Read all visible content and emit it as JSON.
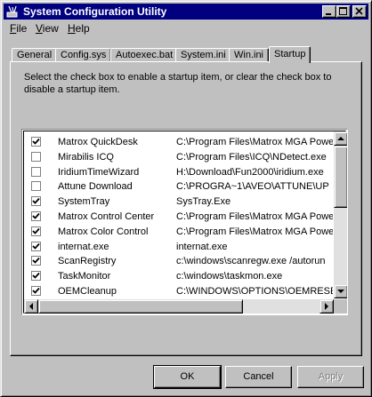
{
  "window": {
    "title": "System Configuration Utility"
  },
  "menubar": [
    {
      "label": "File",
      "mnemonic": "F",
      "rest": "ile"
    },
    {
      "label": "View",
      "mnemonic": "V",
      "rest": "iew"
    },
    {
      "label": "Help",
      "mnemonic": "H",
      "rest": "elp"
    }
  ],
  "tabs": [
    "General",
    "Config.sys",
    "Autoexec.bat",
    "System.ini",
    "Win.ini",
    "Startup"
  ],
  "active_tab": "Startup",
  "description": "Select the check box to enable a startup item, or clear the check box to disable a startup item.",
  "startup_items": [
    {
      "name": "Matrox QuickDesk",
      "command": "C:\\Program Files\\Matrox MGA PowerD",
      "checked": true
    },
    {
      "name": "Mirabilis ICQ",
      "command": "C:\\Program Files\\ICQ\\NDetect.exe",
      "checked": false
    },
    {
      "name": "IridiumTimeWizard",
      "command": "H:\\Download\\Fun2000\\iridium.exe",
      "checked": false
    },
    {
      "name": "Attune Download",
      "command": "C:\\PROGRA~1\\AVEO\\ATTUNE\\UP",
      "checked": false
    },
    {
      "name": "SystemTray",
      "command": "SysTray.Exe",
      "checked": true
    },
    {
      "name": "Matrox Control Center",
      "command": "C:\\Program Files\\Matrox MGA PowerD",
      "checked": true
    },
    {
      "name": "Matrox Color Control",
      "command": "C:\\Program Files\\Matrox MGA PowerD",
      "checked": true
    },
    {
      "name": "internat.exe",
      "command": "internat.exe",
      "checked": true
    },
    {
      "name": "ScanRegistry",
      "command": "c:\\windows\\scanregw.exe /autorun",
      "checked": true
    },
    {
      "name": "TaskMonitor",
      "command": "c:\\windows\\taskmon.exe",
      "checked": true
    },
    {
      "name": "OEMCleanup",
      "command": "C:\\WINDOWS\\OPTIONS\\OEMRESE",
      "checked": true
    }
  ],
  "buttons": {
    "ok": "OK",
    "cancel": "Cancel",
    "apply": "Apply"
  },
  "colors": {
    "titlebar": "#000080",
    "face": "#c0c0c0"
  }
}
